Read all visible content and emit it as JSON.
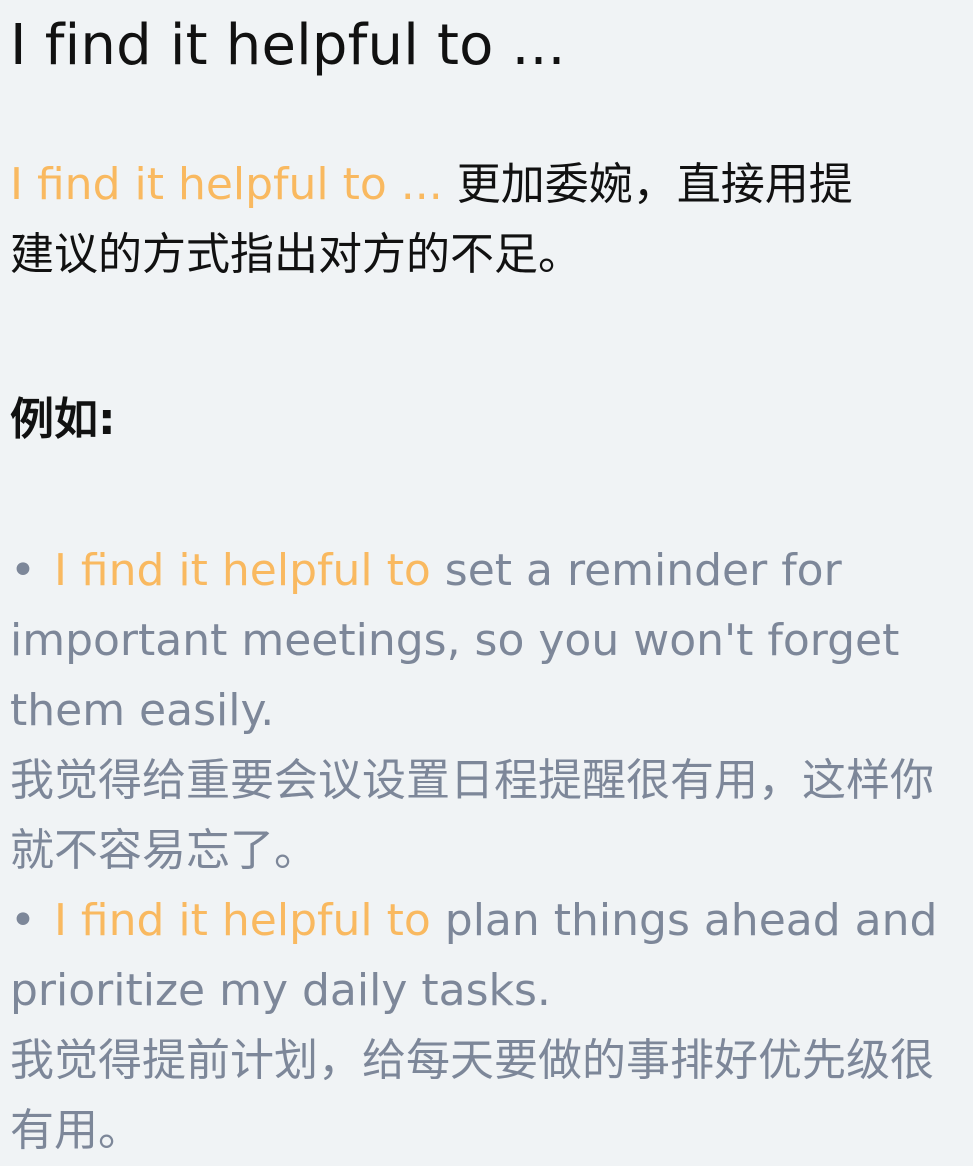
{
  "title": "I find it helpful to ...",
  "intro": {
    "highlight": "I find it helpful to ...",
    "text_line1": " 更加委婉，直接用提",
    "text_line2": "建议的方式指出对方的不足。"
  },
  "examples_label": "例如:",
  "examples": [
    {
      "bullet": "•",
      "highlight": "I find it helpful to",
      "english": " set a reminder for important meetings, so you won't forget them easily.",
      "chinese": "我觉得给重要会议设置日程提醒很有用，这样你就不容易忘了。"
    },
    {
      "bullet": "•",
      "highlight": "I find it helpful to",
      "english": " plan things ahead and prioritize my daily tasks.",
      "chinese": "我觉得提前计划，给每天要做的事排好优先级很有用。"
    }
  ],
  "colors": {
    "background": "#f0f3f5",
    "heading": "#111111",
    "accent": "#f9b960",
    "example_text": "#7d8799"
  }
}
